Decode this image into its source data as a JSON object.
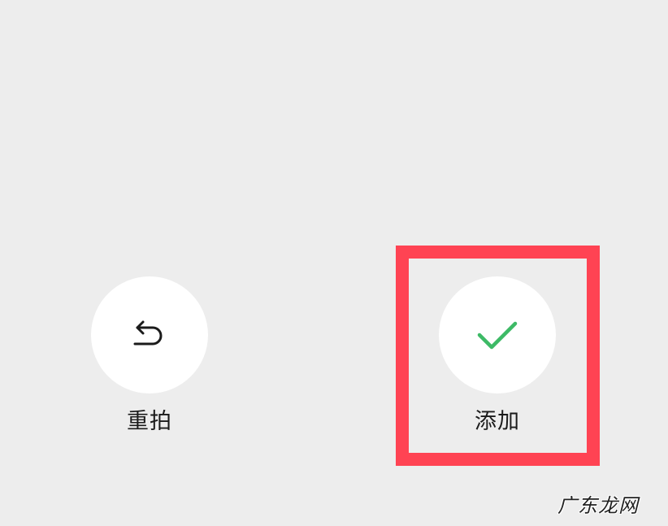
{
  "actions": {
    "retake": {
      "label": "重拍",
      "icon": "undo-arrow-icon"
    },
    "add": {
      "label": "添加",
      "icon": "checkmark-icon",
      "icon_color": "#3dba66"
    }
  },
  "highlight": {
    "color": "#ff4353"
  },
  "watermark": {
    "text": "广东龙网"
  },
  "background_color": "#ededed"
}
